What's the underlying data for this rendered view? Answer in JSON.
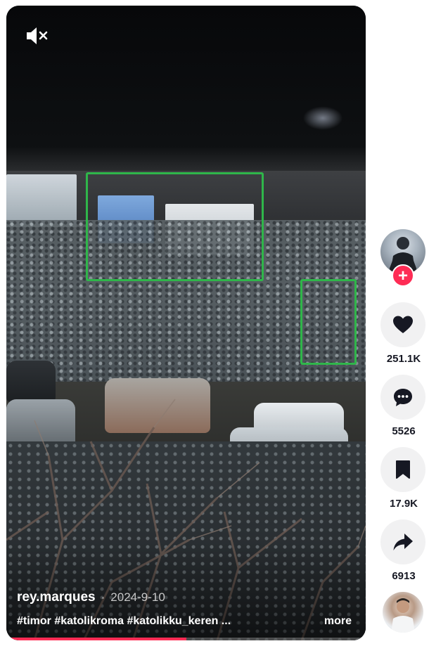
{
  "video": {
    "mute_icon": "speaker-muted-icon",
    "author": "rey.marques",
    "separator": "·",
    "date": "2024-9-10",
    "hashtags": "#timor #katolikroma #katolikku_keren ...",
    "more_label": "more",
    "progress_fraction": 0.5,
    "progress_color": "#fe2c55",
    "annotation_color": "#2fb64a"
  },
  "actions": {
    "follow_label": "+",
    "like": {
      "icon": "heart-icon",
      "count": "251.1K"
    },
    "comment": {
      "icon": "comment-icon",
      "count": "5526"
    },
    "save": {
      "icon": "bookmark-icon",
      "count": "17.9K"
    },
    "share": {
      "icon": "share-icon",
      "count": "6913"
    }
  }
}
